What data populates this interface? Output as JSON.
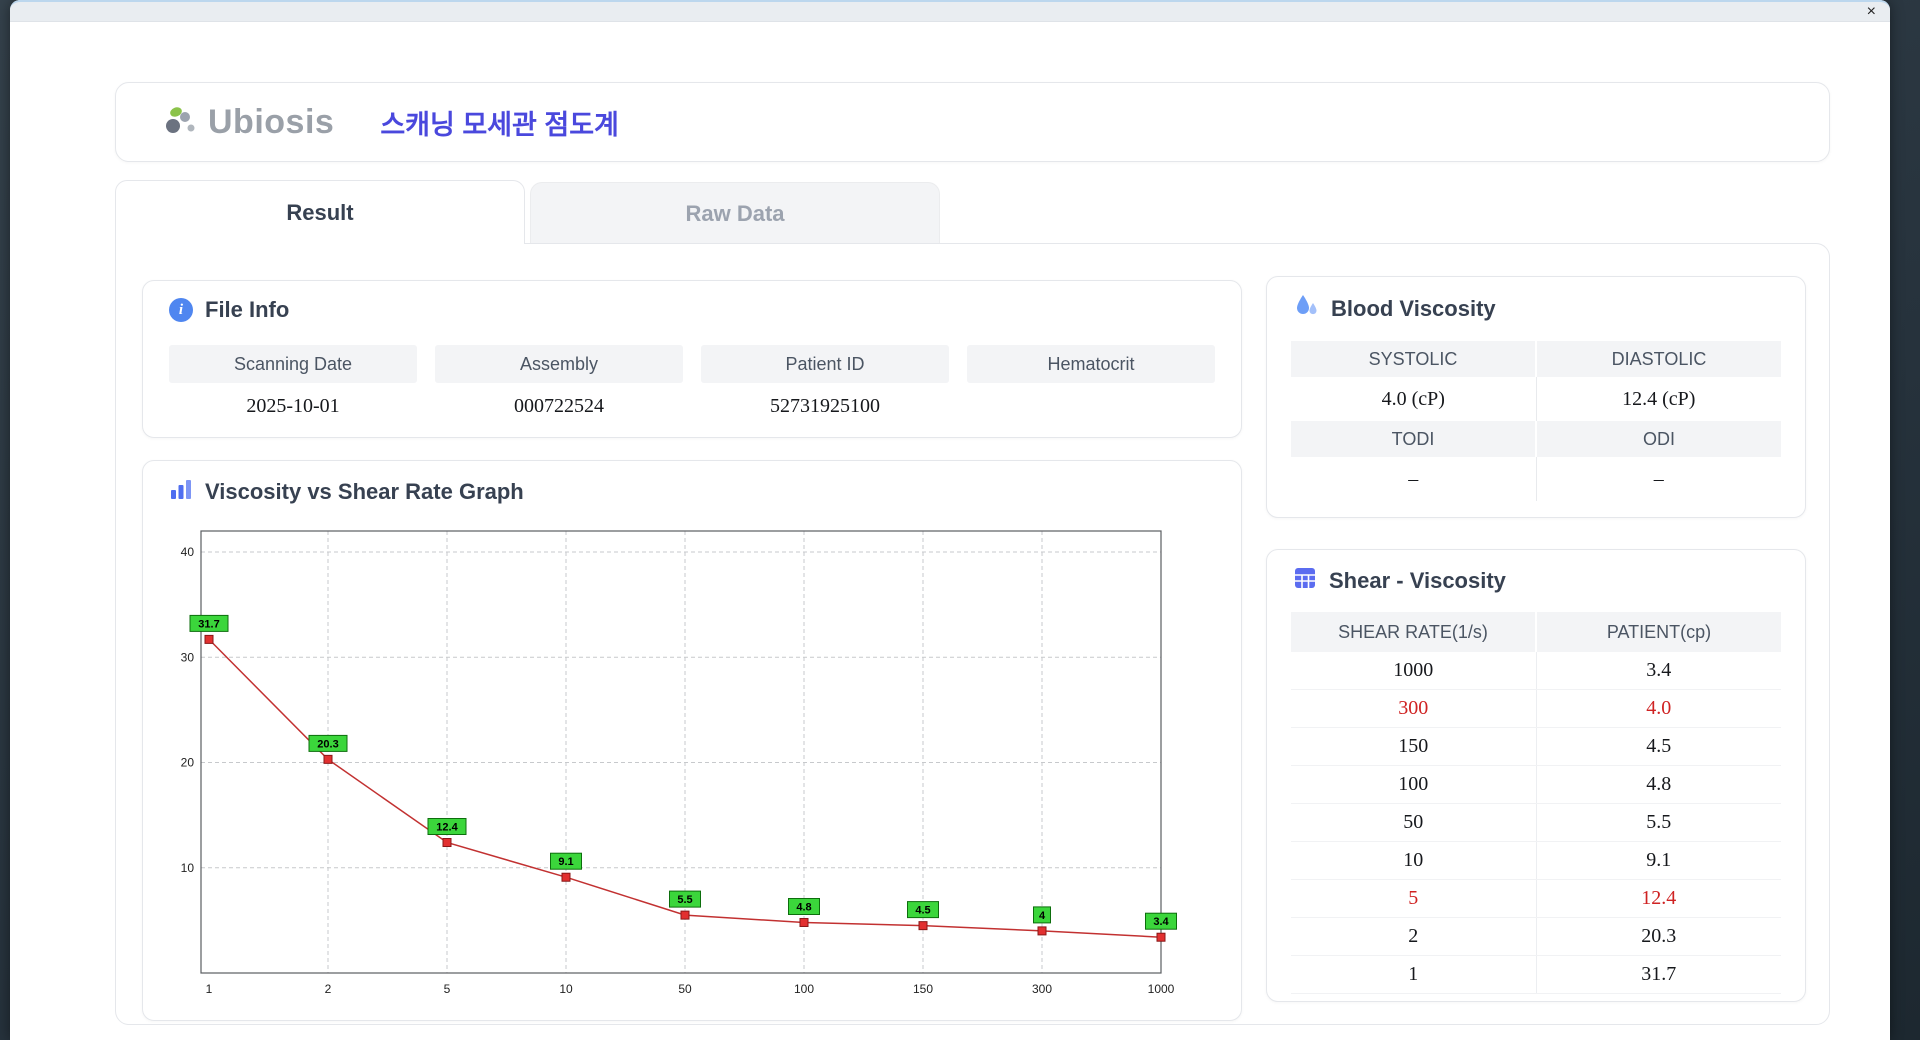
{
  "window": {
    "close_icon": "×"
  },
  "header": {
    "logo_text": "Ubiosis",
    "title": "스캐닝 모세관 점도계"
  },
  "tabs": [
    {
      "label": "Result",
      "active": true
    },
    {
      "label": "Raw Data",
      "active": false
    }
  ],
  "file_info": {
    "title": "File Info",
    "fields": [
      {
        "label": "Scanning Date",
        "value": "2025-10-01"
      },
      {
        "label": "Assembly",
        "value": "000722524"
      },
      {
        "label": "Patient ID",
        "value": "52731925100"
      },
      {
        "label": "Hematocrit",
        "value": ""
      }
    ]
  },
  "graph": {
    "title": "Viscosity vs Shear Rate Graph"
  },
  "chart_data": {
    "type": "line",
    "title": "Viscosity vs Shear Rate Graph",
    "x": [
      1,
      2,
      5,
      10,
      50,
      100,
      150,
      300,
      1000
    ],
    "x_axis_type": "category",
    "series": [
      {
        "name": "Patient",
        "values": [
          31.7,
          20.3,
          12.4,
          9.1,
          5.5,
          4.8,
          4.5,
          4.0,
          3.4
        ]
      }
    ],
    "point_labels": [
      "31.7",
      "20.3",
      "12.4",
      "9.1",
      "5.5",
      "4.8",
      "4.5",
      "4",
      "3.4"
    ],
    "xlabel": "",
    "ylabel": "",
    "yticks": [
      10,
      20,
      30,
      40
    ],
    "ylim": [
      0,
      42
    ],
    "grid": true,
    "line_color": "#c23131",
    "marker_color": "#e23030",
    "label_bg": "#3bd63b"
  },
  "blood_viscosity": {
    "title": "Blood Viscosity",
    "row1": {
      "label1": "SYSTOLIC",
      "label2": "DIASTOLIC",
      "value1": "4.0 (cP)",
      "value2": "12.4 (cP)"
    },
    "row2": {
      "label1": "TODI",
      "label2": "ODI",
      "value1": "–",
      "value2": "–"
    }
  },
  "shear_viscosity": {
    "title": "Shear - Viscosity",
    "columns": [
      "SHEAR RATE(1/s)",
      "PATIENT(cp)"
    ],
    "rows": [
      {
        "rate": "1000",
        "value": "3.4",
        "highlight": false
      },
      {
        "rate": "300",
        "value": "4.0",
        "highlight": true
      },
      {
        "rate": "150",
        "value": "4.5",
        "highlight": false
      },
      {
        "rate": "100",
        "value": "4.8",
        "highlight": false
      },
      {
        "rate": "50",
        "value": "5.5",
        "highlight": false
      },
      {
        "rate": "10",
        "value": "9.1",
        "highlight": false
      },
      {
        "rate": "5",
        "value": "12.4",
        "highlight": true
      },
      {
        "rate": "2",
        "value": "20.3",
        "highlight": false
      },
      {
        "rate": "1",
        "value": "31.7",
        "highlight": false
      }
    ]
  }
}
